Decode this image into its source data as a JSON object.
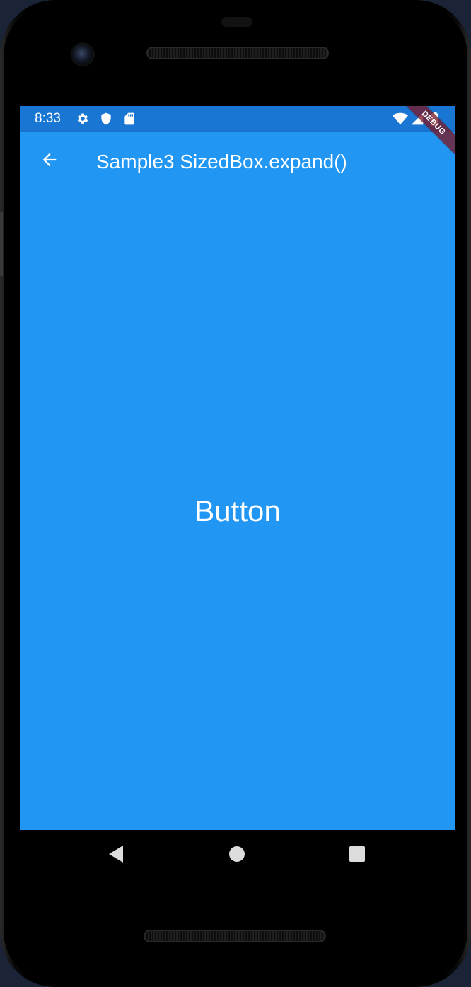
{
  "status_bar": {
    "time": "8:33",
    "left_icons": [
      "gear-icon",
      "shield-icon",
      "sd-card-icon"
    ],
    "right_icons": [
      "wifi-icon",
      "cellular-signal-icon",
      "battery-icon"
    ],
    "background": "#1976d2"
  },
  "app_bar": {
    "title": "Sample3 SizedBox.expand()",
    "back_icon": "arrow-back-icon",
    "background": "#2196f3"
  },
  "body": {
    "button_label": "Button",
    "button_color": "#2196f3"
  },
  "debug_banner": {
    "label": "DEBUG",
    "color": "#7a1a2c"
  },
  "navigation_bar": {
    "buttons": [
      "back-triangle-icon",
      "home-circle-icon",
      "recents-square-icon"
    ]
  }
}
